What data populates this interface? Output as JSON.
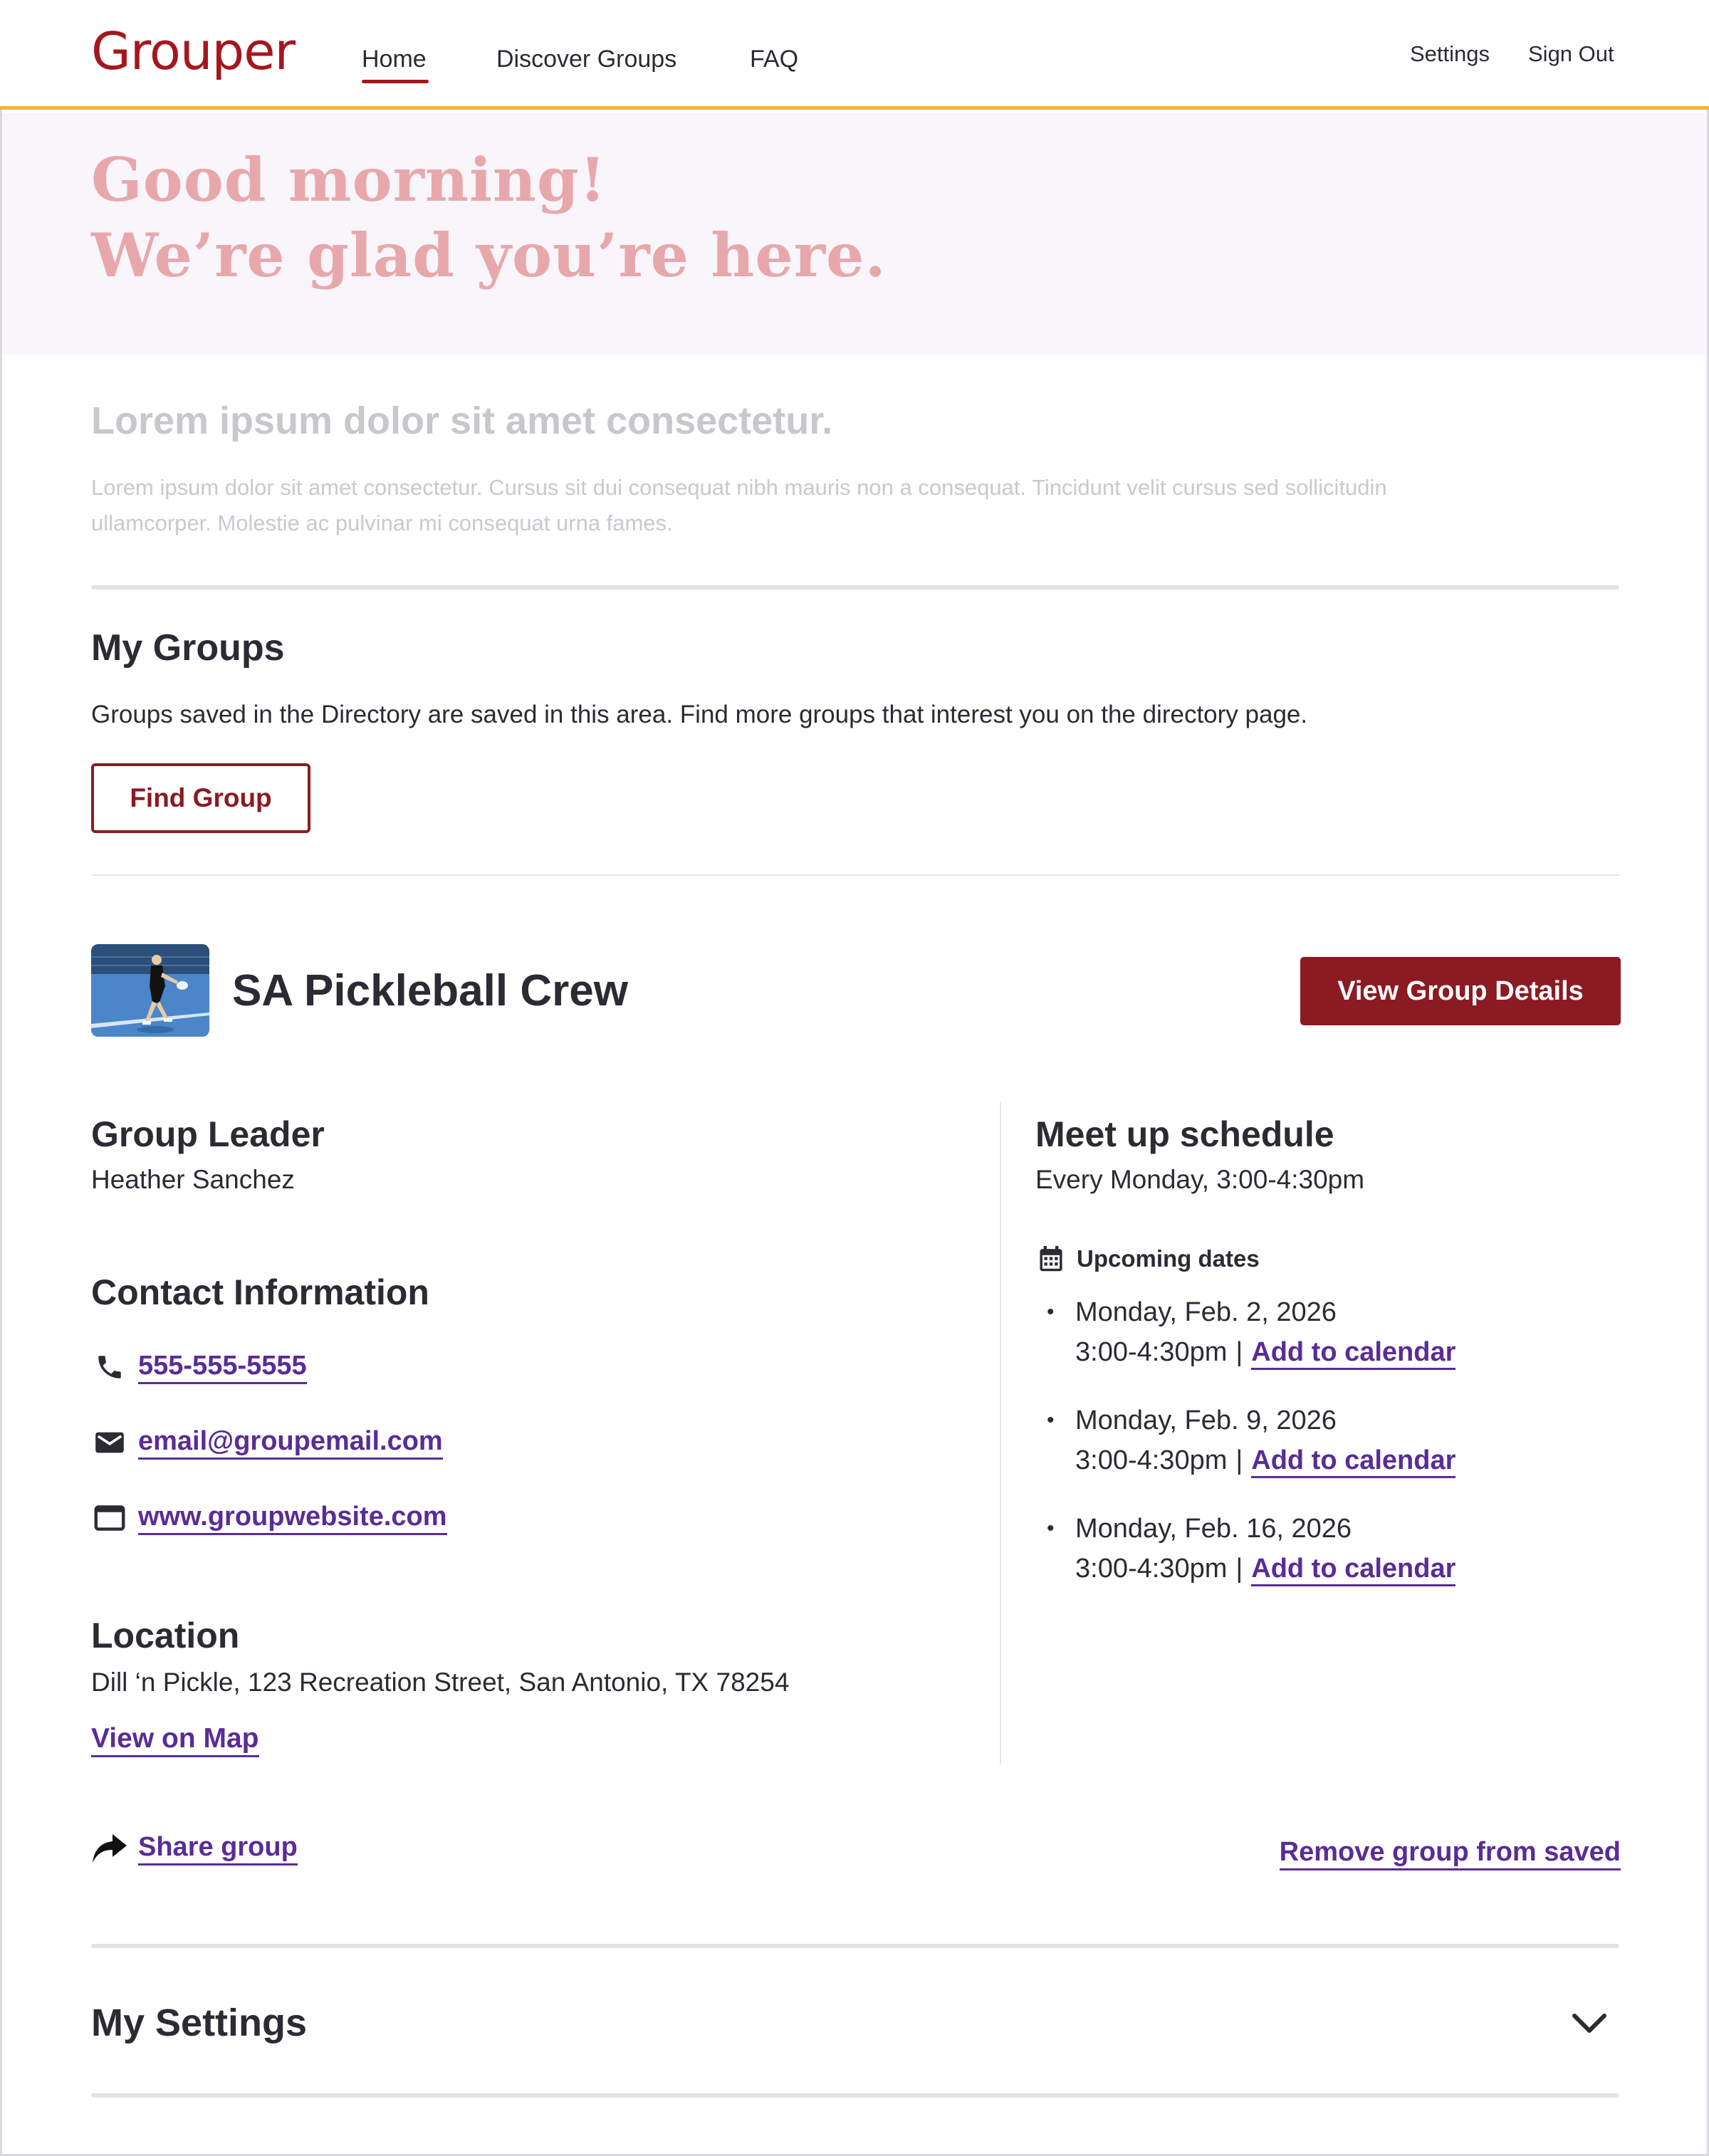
{
  "header": {
    "logo": "Grouper",
    "nav": {
      "home": "Home",
      "discover": "Discover Groups",
      "faq": "FAQ"
    },
    "utility": {
      "settings": "Settings",
      "sign_out": "Sign Out"
    },
    "active_nav": "Home"
  },
  "hero": {
    "line1": "Good morning!",
    "line2": "We’re glad you’re here."
  },
  "intro": {
    "title": "Lorem ipsum dolor sit amet consectetur.",
    "body": "Lorem ipsum dolor sit amet consectetur. Cursus sit dui consequat nibh mauris non a consequat. Tincidunt velit cursus sed sollicitudin ullamcorper. Molestie ac pulvinar mi consequat urna fames."
  },
  "my_groups": {
    "title": "My Groups",
    "description": "Groups saved in the Directory are saved in this area. Find more groups that interest you on the directory page.",
    "find_button": "Find Group"
  },
  "group": {
    "name": "SA Pickleball Crew",
    "view_button": "View Group Details",
    "leader_heading": "Group Leader",
    "leader_name": "Heather Sanchez",
    "contact_heading": "Contact Information",
    "contact": {
      "phone": "555-555-5555",
      "email": "email@groupemail.com",
      "website": "www.groupwebsite.com"
    },
    "location_heading": "Location",
    "location": "Dill ‘n Pickle, 123 Recreation Street, San Antonio, TX 78254",
    "map_link": "View on Map",
    "schedule_heading": "Meet up schedule",
    "schedule": "Every Monday, 3:00-4:30pm",
    "upcoming_label": "Upcoming dates",
    "dates": [
      {
        "day": "Monday, Feb. 2, 2026",
        "time": "3:00-4:30pm",
        "separator": "|",
        "link": "Add to calendar"
      },
      {
        "day": "Monday, Feb. 9, 2026",
        "time": "3:00-4:30pm",
        "separator": "|",
        "link": "Add to calendar"
      },
      {
        "day": "Monday, Feb. 16, 2026",
        "time": "3:00-4:30pm",
        "separator": "|",
        "link": "Add to calendar"
      }
    ],
    "share_link": "Share group",
    "remove_link": "Remove group from saved"
  },
  "settings": {
    "title": "My Settings"
  },
  "icons": {
    "phone": "phone-icon",
    "email": "email-icon",
    "website": "browser-window-icon",
    "calendar": "calendar-icon",
    "share": "share-arrow-icon",
    "expand": "chevron-down-icon"
  },
  "colors": {
    "brand": "#a5171f",
    "button": "#8b1a22",
    "link": "#5a2c96",
    "header_rule": "#f0b53c",
    "hero_bg": "#f8f5fb",
    "hero_text": "#e8a8ab"
  }
}
